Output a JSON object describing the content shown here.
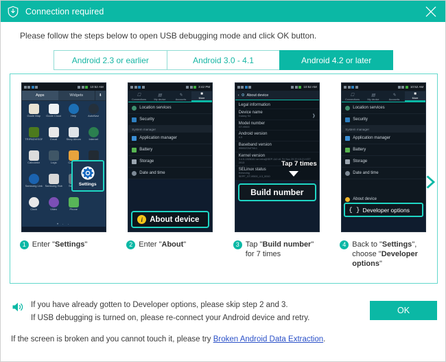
{
  "window": {
    "title": "Connection required",
    "title_icon": "shield-download-icon",
    "close_icon": "close-icon",
    "accent_color": "#0bb8a5",
    "border_color": "#62d8cc"
  },
  "intro": {
    "text": "Please follow the steps below to open USB debugging mode and click OK button."
  },
  "tabs": [
    {
      "label": "Android 2.3 or earlier",
      "active": false
    },
    {
      "label": "Android 3.0 - 4.1",
      "active": false
    },
    {
      "label": "Android 4.2 or later",
      "active": true
    }
  ],
  "next_arrow": {
    "icon": "chevron-right-icon"
  },
  "steps": [
    {
      "number": "1",
      "caption_plain_1": "Enter \"",
      "caption_bold_1": "Settings",
      "caption_plain_2": "\"",
      "phone": {
        "screen": "apps-drawer",
        "status_time": "10:52 AM",
        "tabs": [
          "Apps",
          "Widgets"
        ],
        "selected_tab": "Apps",
        "download_icon": "download-icon",
        "apps": [
          "Goole Map",
          "Goole Cloud",
          "Help",
          "AutoNavi",
          "TRIPADVISOR",
          "Email",
          "Story Album",
          "Internet",
          "Calculator",
          "Logs",
          "Contacts",
          "Phone Book",
          "Samsung Link",
          "Samsung Hub",
          "Settings",
          "Phone",
          "Clock",
          "Video",
          "Phone",
          ""
        ],
        "highlight_label": "Settings",
        "highlight_icon": "gear-icon",
        "page_dots": "3"
      }
    },
    {
      "number": "2",
      "caption_plain_1": "Enter \"",
      "caption_bold_1": "About",
      "caption_plain_2": "\"",
      "phone": {
        "screen": "settings-list",
        "status_time": "3:42 PM",
        "tabs": [
          "Connections",
          "My device",
          "Accounts",
          "More"
        ],
        "selected_tab": "More",
        "rows": [
          {
            "label": "Location services",
            "type": "item"
          },
          {
            "label": "Security",
            "type": "item"
          },
          {
            "label": "System manager",
            "type": "header"
          },
          {
            "label": "Application manager",
            "type": "item"
          },
          {
            "label": "Battery",
            "type": "item"
          },
          {
            "label": "Storage",
            "type": "item"
          },
          {
            "label": "Date and time",
            "type": "item"
          }
        ],
        "highlight_label": "About device",
        "highlight_icon": "info-icon"
      }
    },
    {
      "number": "3",
      "caption_plain_1": "Tap \"",
      "caption_bold_1": "Build number",
      "caption_plain_2": "\" for 7 times",
      "phone": {
        "screen": "about-device",
        "status_time": "10:52 AM",
        "title": "About device",
        "back_icon": "back-chevron-icon",
        "title_icon": "gear-icon",
        "rows": [
          {
            "title": "Legal information",
            "sub": ""
          },
          {
            "title": "Device name",
            "sub": "Galaxy S4",
            "chevron": true
          },
          {
            "title": "Model number",
            "sub": "GT-I9500"
          },
          {
            "title": "Android version",
            "sub": "4.3"
          },
          {
            "title": "Baseband version",
            "sub": "I9500ZOUFML1"
          },
          {
            "title": "Kernel version",
            "sub": "3.4.5-1928161 se.infra@SEP-110 #1 Fri Nov 29 20:15:21 KST 2013"
          },
          {
            "title": "SELinux status",
            "sub": "Enforcing"
          },
          {
            "title": "",
            "sub": "SEPF_GT-I9500_4.3_0010"
          }
        ],
        "callout_text": "Tap 7 times",
        "highlight_label": "Build number"
      }
    },
    {
      "number": "4",
      "caption_plain_1": "Back to \"",
      "caption_bold_1": "Settings",
      "caption_plain_2": "\", choose \"",
      "caption_bold_2": "Developer options",
      "caption_plain_3": "\"",
      "phone": {
        "screen": "settings-list",
        "status_time": "10:52 AM",
        "tabs": [
          "Connections",
          "My device",
          "Accounts",
          "More"
        ],
        "selected_tab": "More",
        "rows": [
          {
            "label": "Location services",
            "type": "item"
          },
          {
            "label": "Security",
            "type": "item"
          },
          {
            "label": "System manager",
            "type": "header"
          },
          {
            "label": "Application manager",
            "type": "item"
          },
          {
            "label": "Battery",
            "type": "item"
          },
          {
            "label": "Storage",
            "type": "item"
          },
          {
            "label": "Date and time",
            "type": "item"
          }
        ],
        "highlight_label": "Developer options",
        "highlight_icon": "braces-icon",
        "last_row_label": "About device"
      }
    }
  ],
  "footer": {
    "speaker_icon": "speaker-icon",
    "note_line_1": "If you have already gotten to Developer options, please skip step 2 and 3.",
    "note_line_2": "If USB debugging is turned on, please re-connect your Android device and retry.",
    "ok_label": "OK",
    "bottom_prefix": "If the screen is broken and you cannot touch it, please try ",
    "bottom_link": "Broken Android Data Extraction",
    "bottom_suffix": "."
  }
}
